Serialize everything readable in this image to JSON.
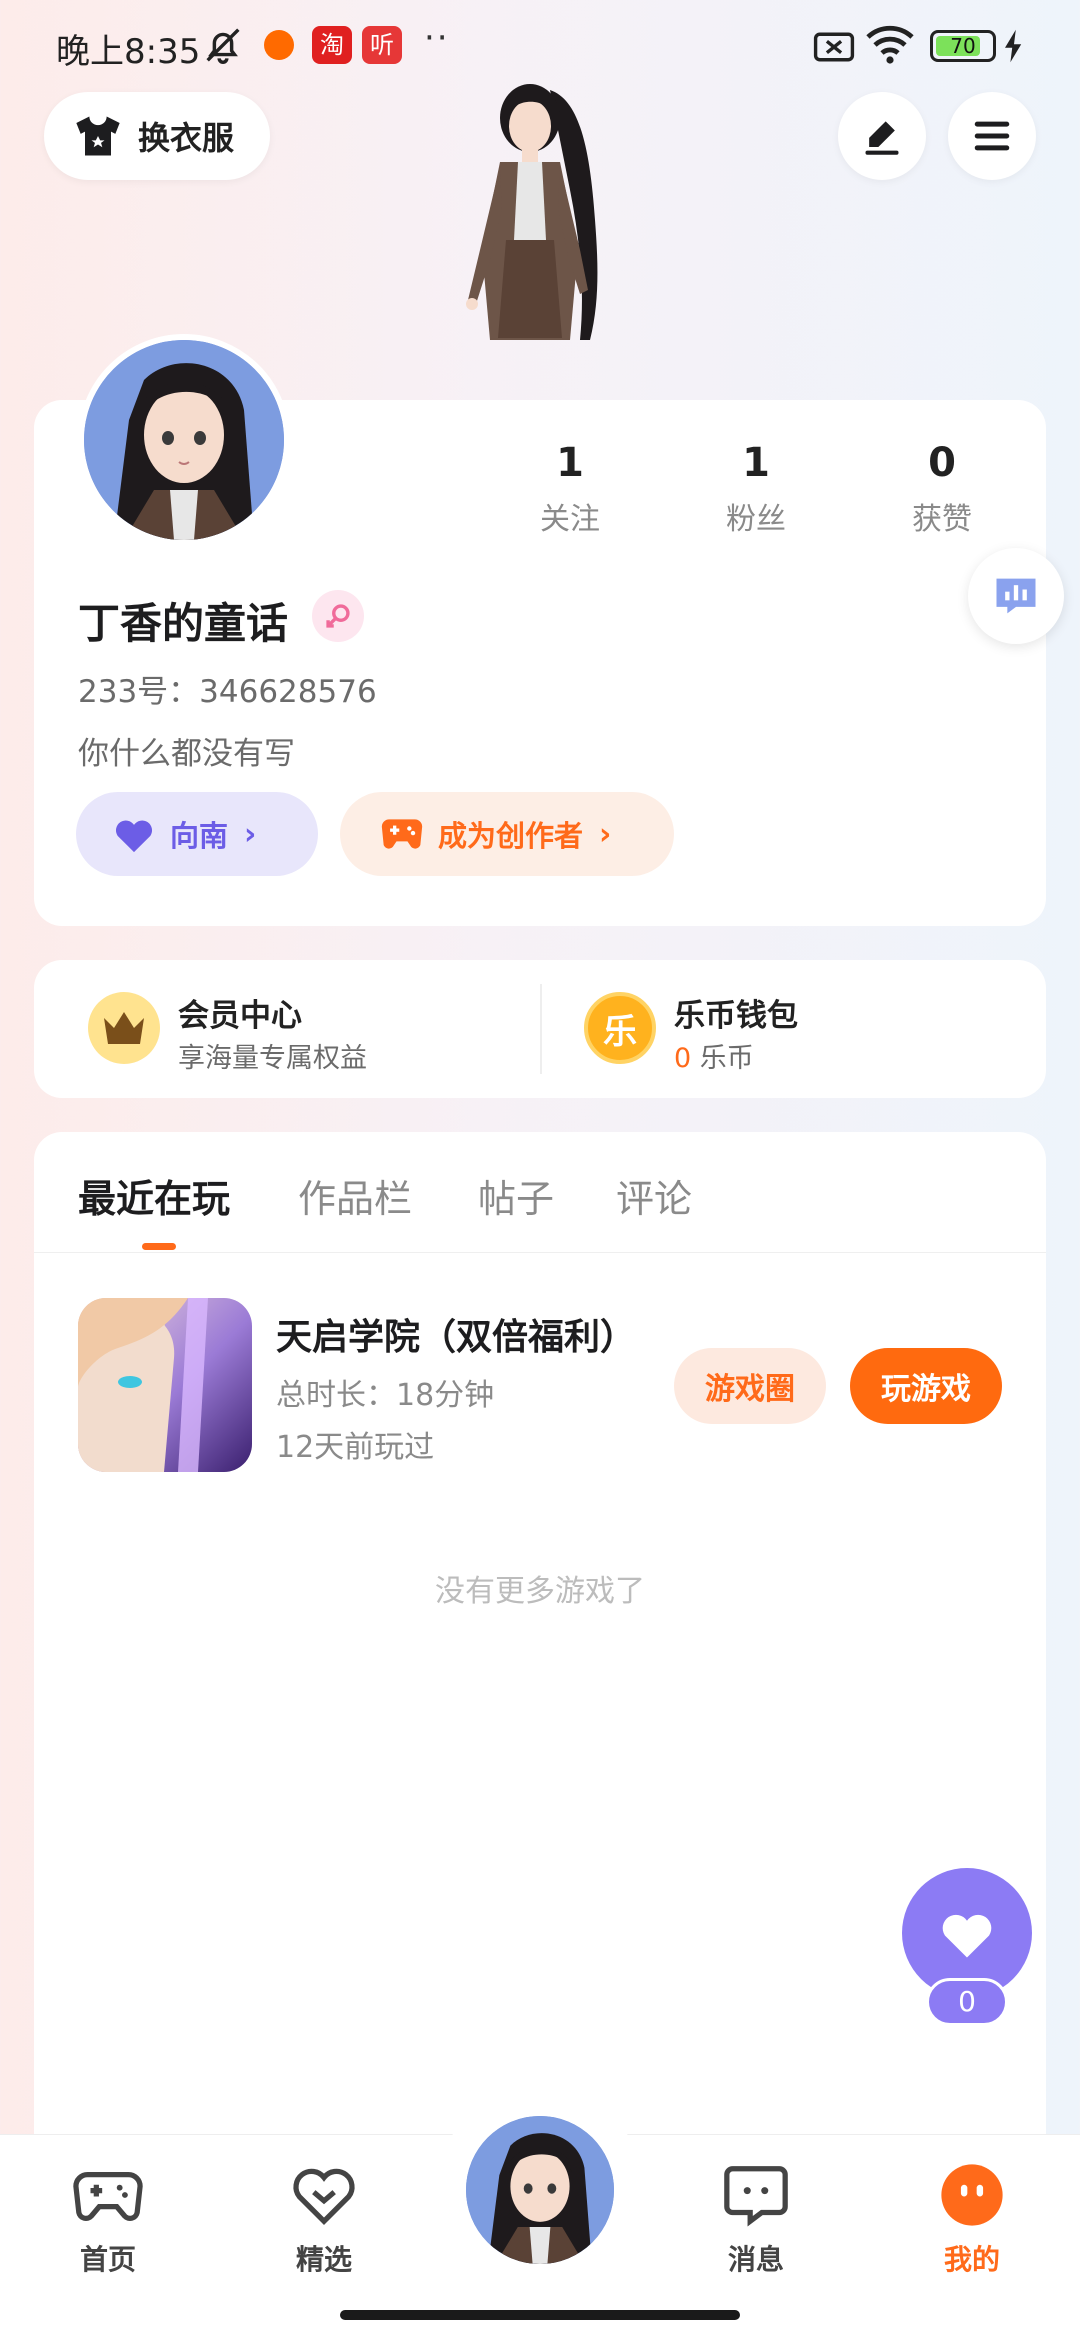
{
  "status_bar": {
    "time": "晚上8:35",
    "app_taobao": "淘",
    "app_ting": "听",
    "dots": "··",
    "battery": "70"
  },
  "top": {
    "dress_label": "换衣服"
  },
  "stats": [
    {
      "value": "1",
      "label": "关注"
    },
    {
      "value": "1",
      "label": "粉丝"
    },
    {
      "value": "0",
      "label": "获赞"
    }
  ],
  "profile": {
    "name": "丁香的童话",
    "id_line": "233号：346628576",
    "bio": "你什么都没有写",
    "tag_pill": "向南",
    "creator_pill": "成为创作者"
  },
  "vip": {
    "title": "会员中心",
    "subtitle": "享海量专属权益",
    "wallet_title": "乐币钱包",
    "wallet_amount": "0",
    "wallet_unit": "乐币",
    "coin_glyph": "乐"
  },
  "tabs": [
    "最近在玩",
    "作品栏",
    "帖子",
    "评论"
  ],
  "game": {
    "name": "天启学院（双倍福利）",
    "duration": "总时长：18分钟",
    "last_played": "12天前玩过",
    "circle_btn": "游戏圈",
    "play_btn": "玩游戏"
  },
  "no_more": "没有更多游戏了",
  "like": {
    "count": "0"
  },
  "nav": [
    {
      "label": "首页"
    },
    {
      "label": "精选"
    },
    {
      "label": "消息"
    },
    {
      "label": "我的"
    }
  ],
  "colors": {
    "accent": "#ff6a1a",
    "purple": "#8c7bf4"
  }
}
